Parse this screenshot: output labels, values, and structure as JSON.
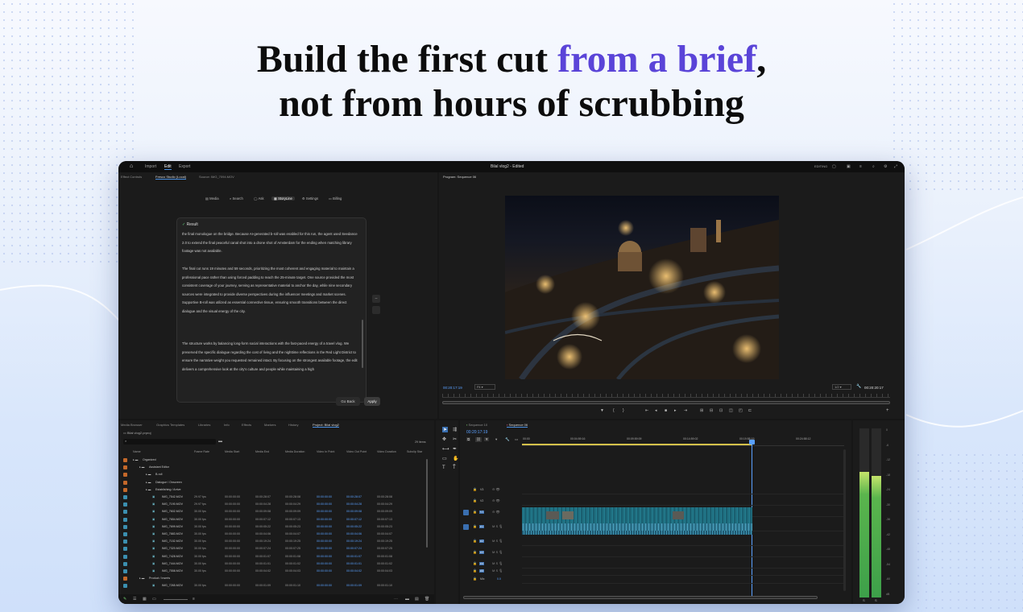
{
  "headline": {
    "line1_pre": "Build the first cut ",
    "line1_highlight": "from a brief",
    "line1_post": ",",
    "line2": "not from hours of scrubbing"
  },
  "topbar": {
    "home_icon": "home-icon",
    "import": "Import",
    "edit": "Edit",
    "export": "Export",
    "title": "Bilal vlog2 - Edited",
    "workspace": "EDITING"
  },
  "left_panel": {
    "tabs": [
      "Effect Controls",
      "Fresco Studio (Local)",
      "Source: IMG_7094.MOV"
    ],
    "toolbar": [
      "Media",
      "Search",
      "Ask",
      "StoryLine",
      "Settings",
      "Billing"
    ],
    "result_label": "Result",
    "paragraphs": [
      "the final monologue on the bridge. Because AI-generated b-roll was enabled for this run, the agent used Seedance 2.0 to extend the final peaceful canal shot into a drone shot of Amsterdam for the ending when matching library footage was not available.",
      "The final cut runs 19 minutes and 59 seconds, prioritizing the most coherent and engaging material to maintain a professional pace rather than using forced padding to reach the 25-minute target. One source provided the most consistent coverage of your journey, serving as representative material to anchor the day, while nine secondary sources were integrated to provide diverse perspectives during the influencer meetings and market scenes. Supportive B-roll was utilized as essential connective tissue, ensuring smooth transitions between the direct dialogue and the visual energy of the city.",
      "The structure works by balancing long-form social interactions with the fast-paced energy of a travel vlog. We preserved the specific dialogue regarding the cost of living and the nighttime reflections in the Red Light District to ensure the narrative weight you requested remained intact. By focusing on the strongest available footage, the edit delivers a comprehensive look at the city's culture and people while maintaining a high"
    ],
    "go_back": "Go Back",
    "apply": "Apply"
  },
  "program": {
    "title": "Program: Sequence 06",
    "timecode_left": "00:20:17:19",
    "fit": "Fit",
    "quality": "1/2",
    "timecode_right": "00:20:20:17"
  },
  "project": {
    "tabs": [
      "Media Browser",
      "Graphics Templates",
      "Libraries",
      "Info",
      "Effects",
      "Markers",
      "History",
      "Project: Bilal vlog2"
    ],
    "file": "Bilal vlog2.prproj",
    "items_count": "29 items",
    "columns": [
      "Name",
      "Frame Rate",
      "Media Start",
      "Media End",
      "Media Duration",
      "Video In Point",
      "Video Out Point",
      "Video Duration",
      "Subclip Star"
    ],
    "rows": [
      {
        "indent": 0,
        "type": "folder",
        "name": "Organized",
        "vals": [
          "",
          "",
          "",
          "",
          "",
          "",
          "",
          ""
        ]
      },
      {
        "indent": 1,
        "type": "folder",
        "name": "Assistant Editor",
        "vals": [
          "",
          "",
          "",
          "",
          "",
          "",
          "",
          ""
        ]
      },
      {
        "indent": 2,
        "type": "folder",
        "name": "B-roll",
        "vals": [
          "",
          "",
          "",
          "",
          "",
          "",
          "",
          ""
        ]
      },
      {
        "indent": 2,
        "type": "folder",
        "name": "Dialogue / Onscreen",
        "vals": [
          "",
          "",
          "",
          "",
          "",
          "",
          "",
          ""
        ]
      },
      {
        "indent": 2,
        "type": "folder",
        "name": "Establishing / Arrive",
        "vals": [
          "",
          "",
          "",
          "",
          "",
          "",
          "",
          ""
        ]
      },
      {
        "indent": 3,
        "type": "file",
        "name": "IMG_7542.MOV",
        "vals": [
          "29.97 fps",
          "00:00:00:00",
          "00:00:28:07",
          "00:00:28:08",
          "00:00:00:00",
          "00:00:28:07",
          "00:00:28:08"
        ]
      },
      {
        "indent": 3,
        "type": "file",
        "name": "IMG_7190.MOV",
        "vals": [
          "29.97 fps",
          "00:00:00:00",
          "00:00:04:28",
          "00:00:04:29",
          "00:00:00:00",
          "00:00:04:28",
          "00:00:04:29"
        ]
      },
      {
        "indent": 3,
        "type": "file",
        "name": "IMG_7602.MOV",
        "vals": [
          "30.00 fps",
          "00:00:00:00",
          "00:00:09:08",
          "00:00:09:09",
          "00:00:00:00",
          "00:00:09:08",
          "00:00:09:09"
        ]
      },
      {
        "indent": 3,
        "type": "file",
        "name": "IMG_7654.MOV",
        "vals": [
          "30.00 fps",
          "00:00:00:00",
          "00:00:07:12",
          "00:00:07:13",
          "00:00:00:00",
          "00:00:07:12",
          "00:00:07:13"
        ]
      },
      {
        "indent": 3,
        "type": "file",
        "name": "IMG_7699.MOV",
        "vals": [
          "30.00 fps",
          "00:00:00:00",
          "00:00:05:22",
          "00:00:05:23",
          "00:00:00:00",
          "00:00:05:22",
          "00:00:05:23"
        ]
      },
      {
        "indent": 3,
        "type": "file",
        "name": "IMG_7883.MOV",
        "vals": [
          "30.00 fps",
          "00:00:00:00",
          "00:00:04:06",
          "00:00:04:07",
          "00:00:00:00",
          "00:00:04:06",
          "00:00:04:07"
        ]
      },
      {
        "indent": 3,
        "type": "file",
        "name": "IMG_7152.MOV",
        "vals": [
          "30.00 fps",
          "00:00:00:00",
          "00:00:19:24",
          "00:00:19:25",
          "00:00:00:00",
          "00:00:19:24",
          "00:00:19:25"
        ]
      },
      {
        "indent": 3,
        "type": "file",
        "name": "IMG_7320.MOV",
        "vals": [
          "30.00 fps",
          "00:00:00:00",
          "00:00:07:24",
          "00:00:07:25",
          "00:00:00:00",
          "00:00:07:24",
          "00:00:07:25"
        ]
      },
      {
        "indent": 3,
        "type": "file",
        "name": "IMG_7428.MOV",
        "vals": [
          "30.00 fps",
          "00:00:00:00",
          "00:00:01:07",
          "00:00:01:08",
          "00:00:00:00",
          "00:00:01:07",
          "00:00:01:08"
        ]
      },
      {
        "indent": 3,
        "type": "file",
        "name": "IMG_7444.MOV",
        "vals": [
          "30.00 fps",
          "00:00:00:00",
          "00:00:01:01",
          "00:00:01:02",
          "00:00:00:00",
          "00:00:01:01",
          "00:00:01:02"
        ]
      },
      {
        "indent": 3,
        "type": "file",
        "name": "IMG_7558.MOV",
        "vals": [
          "30.00 fps",
          "00:00:00:00",
          "00:00:04:02",
          "00:00:04:03",
          "00:00:00:00",
          "00:00:04:02",
          "00:00:04:03"
        ]
      },
      {
        "indent": 1,
        "type": "folder",
        "name": "Product / Inserts",
        "vals": [
          "",
          "",
          "",
          "",
          "",
          "",
          "",
          ""
        ]
      },
      {
        "indent": 3,
        "type": "file",
        "name": "IMG_7265.MOV",
        "vals": [
          "30.00 fps",
          "00:00:00:00",
          "00:00:01:09",
          "00:00:01:10",
          "00:00:00:00",
          "00:00:01:09",
          "00:00:01:10"
        ]
      }
    ]
  },
  "timeline": {
    "tabs": [
      "Sequence 10",
      "Sequence 06"
    ],
    "timecode": "00:20:17:19",
    "ruler": [
      "00:00",
      "00:04:59:16",
      "00:09:59:09",
      "00:14:59:02",
      "00:19:58:19",
      "00:24:58:12"
    ],
    "tracks": [
      "V3",
      "V2",
      "V1",
      "A1",
      "A2",
      "A3",
      "A4",
      "A5",
      "Mix"
    ],
    "mix_value": "0.0"
  },
  "meter": {
    "labels": [
      "0",
      "-6",
      "-12",
      "-18",
      "-24",
      "-30",
      "-36",
      "-42",
      "-48",
      "-54",
      "-60",
      "dB"
    ],
    "channels": [
      "S",
      "S"
    ]
  }
}
